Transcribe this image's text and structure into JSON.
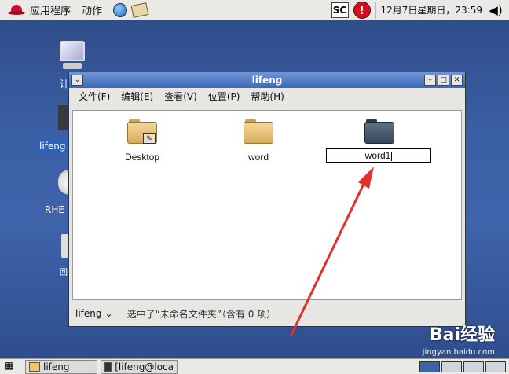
{
  "top_panel": {
    "apps_menu": "应用程序",
    "actions_menu": "动作",
    "sc_label": "SC",
    "alert_label": "!",
    "clock": "12月7日星期日，23:59"
  },
  "desktop": {
    "computer_label_partial": "计",
    "home_label": "lifeng",
    "cd_label_partial": "RHE",
    "trash_label_partial": "回"
  },
  "window": {
    "title": "lifeng",
    "menu": [
      "文件(F)",
      "编辑(E)",
      "查看(V)",
      "位置(P)",
      "帮助(H)"
    ],
    "files": [
      {
        "name": "Desktop",
        "style": "desktop"
      },
      {
        "name": "word",
        "style": "tan"
      },
      {
        "name": "word1",
        "style": "dark",
        "renaming": true
      }
    ],
    "location_label": "lifeng",
    "status_text": "选中了“未命名文件夹”（含有 0 项）"
  },
  "taskbar": {
    "tasks": [
      "lifeng",
      "[lifeng@loca"
    ]
  },
  "watermark": {
    "brand": "Bai经验",
    "url": "jingyan.baidu.com"
  },
  "colors": {
    "titlebar": "#3d68b6",
    "desktop": "#3b5fa4",
    "arrow": "#e0302a"
  }
}
